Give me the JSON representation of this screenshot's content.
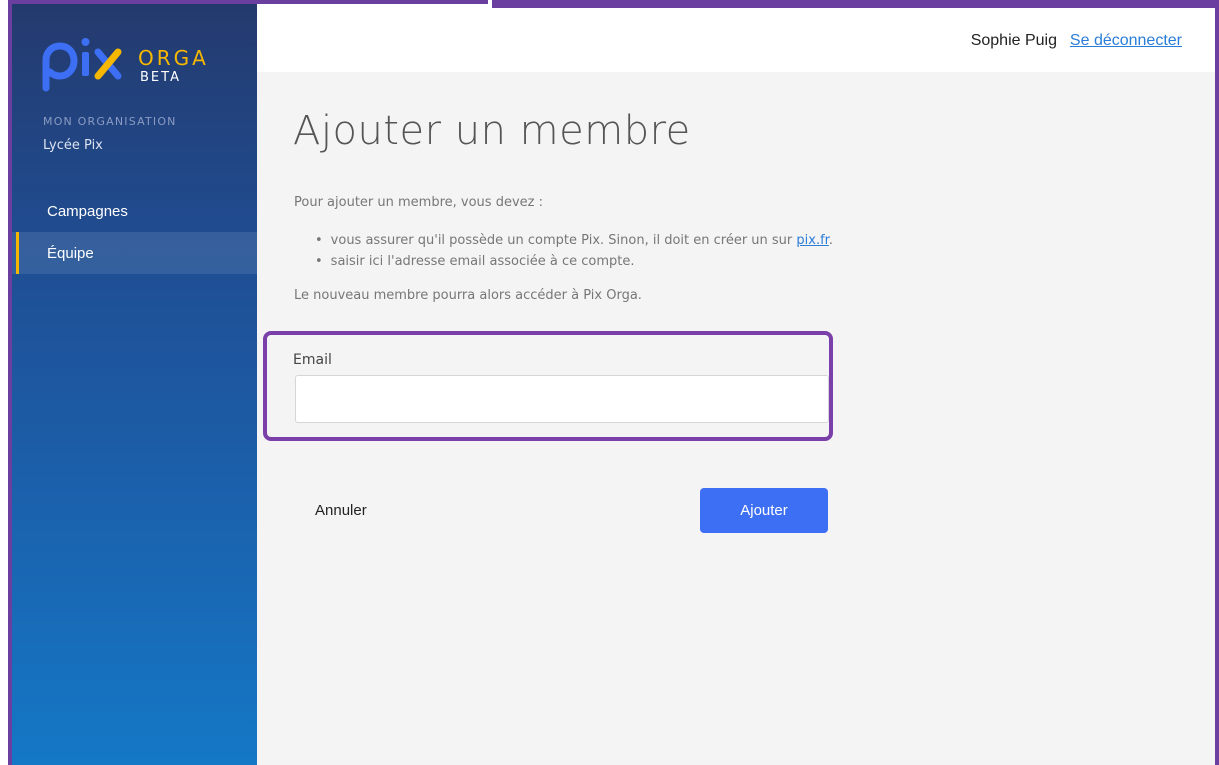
{
  "brand": {
    "logo_text": "pix",
    "product": "ORGA",
    "badge": "BETA",
    "colors": {
      "logo_blue": "#3d6ff4",
      "logo_yellow": "#f5b700"
    }
  },
  "sidebar": {
    "org_label": "MON ORGANISATION",
    "org_name": "Lycée Pix",
    "items": [
      {
        "label": "Campagnes",
        "active": false
      },
      {
        "label": "Équipe",
        "active": true
      }
    ]
  },
  "header": {
    "user_name": "Sophie Puig",
    "logout_label": "Se déconnecter"
  },
  "main": {
    "title": "Ajouter un membre",
    "intro": "Pour ajouter un membre, vous devez :",
    "bullet_1_text": "vous assurer qu'il possède un compte Pix. Sinon, il doit en créer un sur ",
    "bullet_1_link": "pix.fr",
    "bullet_1_end": ".",
    "bullet_2": "saisir ici l'adresse email associée à ce compte.",
    "outro": "Le nouveau membre pourra alors accéder à Pix Orga.",
    "email_label": "Email",
    "email_value": "",
    "cancel_label": "Annuler",
    "submit_label": "Ajouter"
  },
  "colors": {
    "accent": "#3d6ff4",
    "highlight_frame": "#7a3fa8",
    "active_indicator": "#f5b700",
    "link": "#2a7dd8"
  }
}
